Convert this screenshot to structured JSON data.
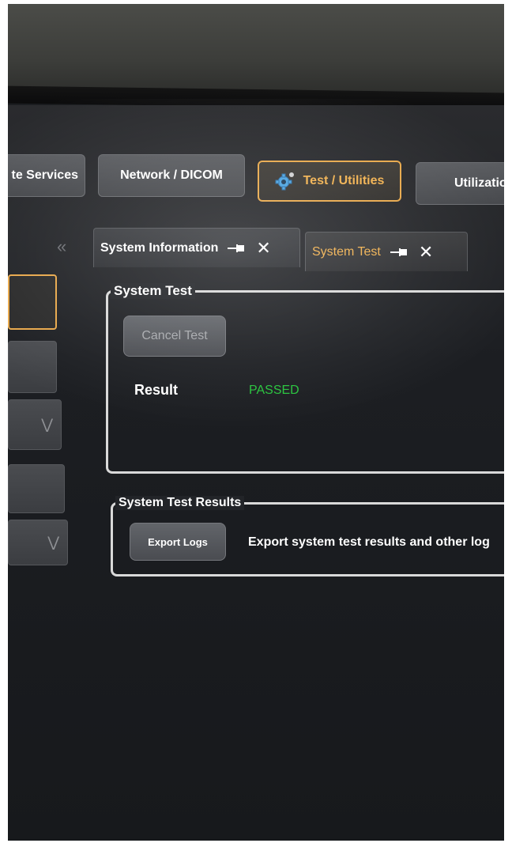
{
  "nav": {
    "remote_services": "te Services",
    "network_dicom": "Network / DICOM",
    "test_utilities": "Test / Utilities",
    "utilization": "Utilizatio"
  },
  "tabs": [
    {
      "label": "System Information"
    },
    {
      "label": "System Test"
    }
  ],
  "system_test": {
    "title": "System Test",
    "cancel_label": "Cancel Test",
    "result_label": "Result",
    "result_value": "PASSED"
  },
  "system_test_results": {
    "title": "System Test Results",
    "export_label": "Export Logs",
    "export_description": "Export system test results and other log"
  },
  "colors": {
    "accent": "#e8a84a",
    "passed": "#27c33c",
    "background": "#1c1e22"
  }
}
